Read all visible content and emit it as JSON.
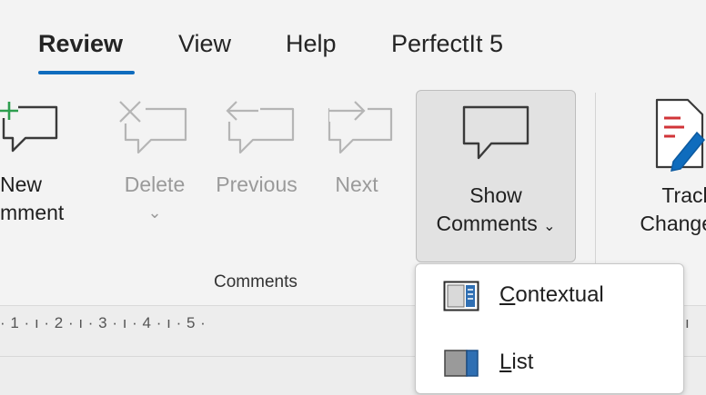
{
  "tabs": [
    {
      "label": "Review",
      "active": true
    },
    {
      "label": "View"
    },
    {
      "label": "Help"
    },
    {
      "label": "PerfectIt 5"
    }
  ],
  "ribbon": {
    "new_comment": {
      "line1": "New",
      "line2": "mment"
    },
    "delete": {
      "line1": "Delete",
      "chevron": "⌄"
    },
    "previous": {
      "line1": "Previous"
    },
    "next": {
      "line1": "Next"
    },
    "show_comments": {
      "line1": "Show",
      "line2": "Comments",
      "chevron": "⌄"
    },
    "track_changes": {
      "line1": "Track",
      "line2": "Change"
    },
    "group_label": "Comments"
  },
  "ruler": {
    "text": "· 1 · ı · 2 · ı · 3 · ı · 4 · ı · 5 ·",
    "right_text": "ı"
  },
  "dropdown": {
    "items": [
      {
        "label": "Contextual",
        "accel": "C",
        "rest": "ontextual",
        "icon": "contextual-view-icon"
      },
      {
        "label": "List",
        "accel": "L",
        "rest": "ist",
        "icon": "list-view-icon"
      }
    ]
  },
  "colors": {
    "accent": "#0f6cbd",
    "new_comment_plus": "#2e9e4f",
    "track_red": "#d13438",
    "track_blue": "#0f6cbd"
  }
}
